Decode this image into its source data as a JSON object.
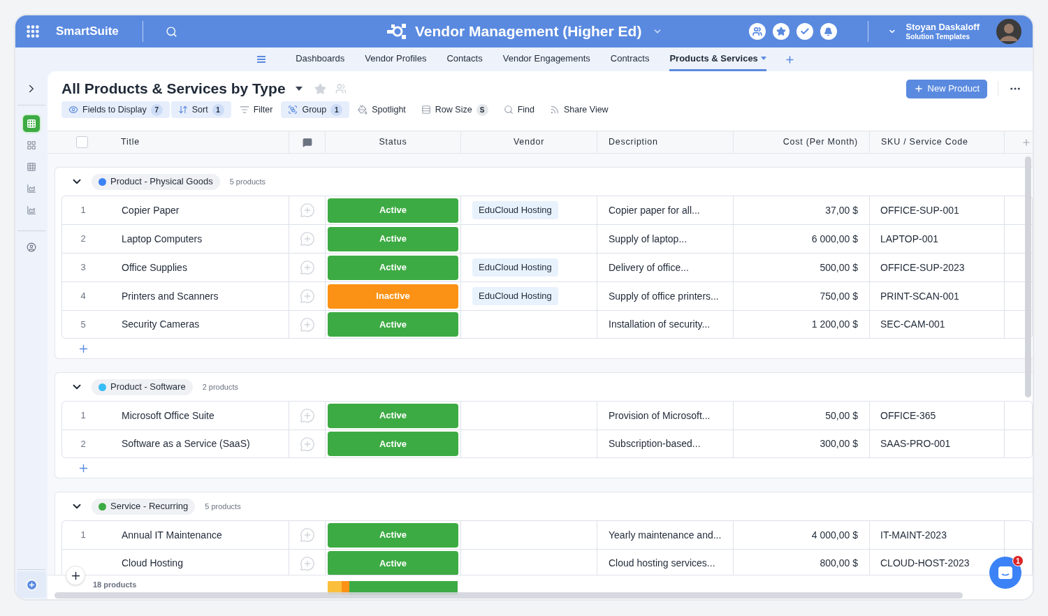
{
  "app": {
    "name": "SmartSuite",
    "title": "Vendor Management (Higher Ed)",
    "user": {
      "name": "Stoyan Daskaloff",
      "subtitle": "Solution Templates"
    }
  },
  "nav_tabs": [
    {
      "label": "Dashboards",
      "selected": false
    },
    {
      "label": "Vendor Profiles",
      "selected": false
    },
    {
      "label": "Contacts",
      "selected": false
    },
    {
      "label": "Vendor Engagements",
      "selected": false
    },
    {
      "label": "Contracts",
      "selected": false
    },
    {
      "label": "Products & Services",
      "selected": true
    }
  ],
  "views": [
    {
      "kind": "grid",
      "selected": true
    },
    {
      "kind": "dots",
      "selected": false
    },
    {
      "kind": "grid",
      "selected": false
    },
    {
      "kind": "chart",
      "selected": false
    },
    {
      "kind": "chart",
      "selected": false
    }
  ],
  "view": {
    "title": "All Products & Services by Type",
    "new_button": "New Product",
    "toolbar": [
      {
        "kind": "eye",
        "label": "Fields to Display",
        "count": "7",
        "active": true
      },
      {
        "kind": "sort",
        "label": "Sort",
        "count": "1",
        "active": true
      },
      {
        "kind": "filter",
        "label": "Filter",
        "active": false
      },
      {
        "kind": "group",
        "label": "Group",
        "count": "1",
        "active": true
      },
      {
        "kind": "spotlight",
        "label": "Spotlight",
        "active": false
      },
      {
        "kind": "rowsize",
        "label": "Row Size",
        "count": "S",
        "active": false
      },
      {
        "kind": "find",
        "label": "Find",
        "active": false
      },
      {
        "kind": "share",
        "label": "Share View",
        "active": false
      }
    ]
  },
  "select_all": {
    "checked": false
  },
  "columns": [
    "Title",
    "Status",
    "Vendor",
    "Description",
    "Cost (Per Month)",
    "SKU / Service Code"
  ],
  "groups": [
    {
      "label": "Product - Physical Goods",
      "color": "#3b82f6",
      "count": "5 products",
      "rows": [
        {
          "number": "1",
          "title": "Copier Paper",
          "status": {
            "label": "Active",
            "kind": "active"
          },
          "vendor": "EduCloud Hosting",
          "description": "Copier paper for all...",
          "cost": "37,00 $",
          "sku": "OFFICE-SUP-001"
        },
        {
          "number": "2",
          "title": "Laptop Computers",
          "status": {
            "label": "Active",
            "kind": "active"
          },
          "description": "Supply of laptop...",
          "cost": "6 000,00 $",
          "sku": "LAPTOP-001"
        },
        {
          "number": "3",
          "title": "Office Supplies",
          "status": {
            "label": "Active",
            "kind": "active"
          },
          "vendor": "EduCloud Hosting",
          "description": "Delivery of office...",
          "cost": "500,00 $",
          "sku": "OFFICE-SUP-2023"
        },
        {
          "number": "4",
          "title": "Printers and Scanners",
          "status": {
            "label": "Inactive",
            "kind": "inactive"
          },
          "vendor": "EduCloud Hosting",
          "description": "Supply of office printers...",
          "cost": "750,00 $",
          "sku": "PRINT-SCAN-001"
        },
        {
          "number": "5",
          "title": "Security Cameras",
          "status": {
            "label": "Active",
            "kind": "active"
          },
          "description": "Installation of security...",
          "cost": "1 200,00 $",
          "sku": "SEC-CAM-001"
        }
      ]
    },
    {
      "label": "Product - Software",
      "color": "#38bdf8",
      "count": "2 products",
      "rows": [
        {
          "number": "1",
          "title": "Microsoft Office Suite",
          "status": {
            "label": "Active",
            "kind": "active"
          },
          "description": "Provision of Microsoft...",
          "cost": "50,00 $",
          "sku": "OFFICE-365"
        },
        {
          "number": "2",
          "title": "Software as a Service (SaaS)",
          "status": {
            "label": "Active",
            "kind": "active"
          },
          "description": "Subscription-based...",
          "cost": "300,00 $",
          "sku": "SAAS-PRO-001"
        }
      ]
    },
    {
      "label": "Service - Recurring",
      "color": "#3dab43",
      "count": "5 products",
      "rows": [
        {
          "number": "1",
          "title": "Annual IT Maintenance",
          "status": {
            "label": "Active",
            "kind": "active"
          },
          "description": "Yearly maintenance and...",
          "cost": "4 000,00 $",
          "sku": "IT-MAINT-2023"
        },
        {
          "title": "Cloud Hosting",
          "status": {
            "label": "Active",
            "kind": "active"
          },
          "description": "Cloud hosting services...",
          "cost": "800,00 $",
          "sku": "CLOUD-HOST-2023"
        }
      ]
    }
  ],
  "footer": {
    "count": "18 products",
    "summary": [
      {
        "color": "#fbbf3c"
      },
      {
        "color": "#fb9215"
      },
      {
        "color": "#3dab43"
      }
    ]
  },
  "chat": {
    "badge": "1"
  }
}
